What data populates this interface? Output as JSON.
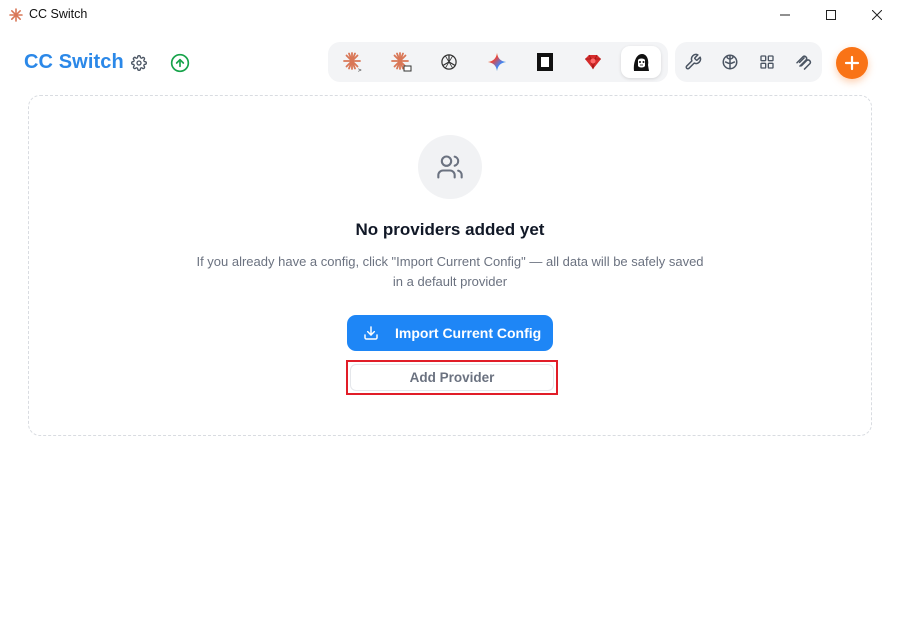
{
  "window": {
    "title": "CC Switch",
    "controls": [
      "minimize",
      "maximize",
      "close"
    ]
  },
  "header": {
    "brand": "CC Switch",
    "settings_icon": "gear-icon",
    "update_icon": "arrow-up-circle-icon",
    "apps": [
      {
        "name": "claude-code",
        "icon": "claude-starburst-icon",
        "active": false
      },
      {
        "name": "claude-desktop",
        "icon": "claude-desktop-icon",
        "active": false
      },
      {
        "name": "codex",
        "icon": "openai-icon",
        "active": false
      },
      {
        "name": "gemini",
        "icon": "gemini-icon",
        "active": false
      },
      {
        "name": "opencode",
        "icon": "opencode-icon",
        "active": false
      },
      {
        "name": "ruby",
        "icon": "red-gem-icon",
        "active": false
      },
      {
        "name": "openclaw",
        "icon": "mascot-icon",
        "active": true
      }
    ],
    "tools": [
      {
        "name": "tools",
        "icon": "wrench-icon"
      },
      {
        "name": "skills",
        "icon": "brain-icon"
      },
      {
        "name": "apps",
        "icon": "grid-icon"
      },
      {
        "name": "mcp",
        "icon": "paperclip-icon"
      }
    ],
    "add_icon": "plus-icon",
    "accent": "#f97316",
    "brand_color": "#2b88e8"
  },
  "empty_state": {
    "icon": "users-icon",
    "title": "No providers added yet",
    "description": "If you already have a config, click \"Import Current Config\" — all data will be safely saved in a default provider",
    "import_label": "Import Current Config",
    "add_label": "Add Provider"
  }
}
